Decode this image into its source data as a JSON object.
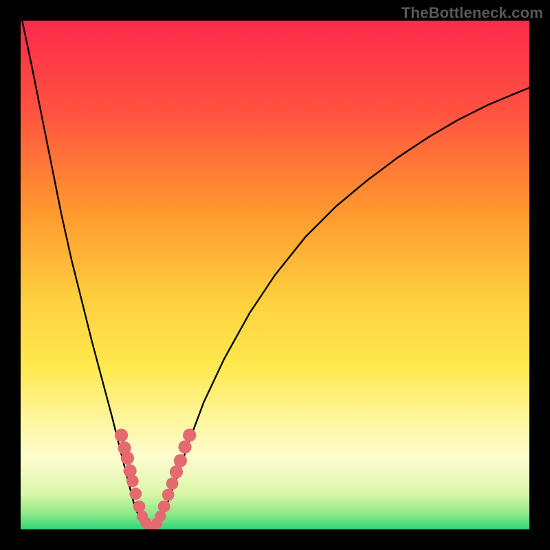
{
  "watermark": {
    "text": "TheBottleneck.com"
  },
  "chart_data": {
    "type": "line",
    "title": "",
    "xlabel": "",
    "ylabel": "",
    "xlim": [
      0,
      100
    ],
    "ylim": [
      0,
      100
    ],
    "gradient_stops": [
      {
        "offset": 0,
        "color": "#ff2a4d"
      },
      {
        "offset": 18,
        "color": "#ff5340"
      },
      {
        "offset": 38,
        "color": "#ff9a2e"
      },
      {
        "offset": 55,
        "color": "#ffd040"
      },
      {
        "offset": 68,
        "color": "#ffe94f"
      },
      {
        "offset": 78,
        "color": "#fff59a"
      },
      {
        "offset": 86,
        "color": "#fdfccf"
      },
      {
        "offset": 93,
        "color": "#d9f7a8"
      },
      {
        "offset": 97,
        "color": "#8de88a"
      },
      {
        "offset": 100,
        "color": "#2fd77a"
      }
    ],
    "series": [
      {
        "name": "curve",
        "points": [
          {
            "x": 0.3,
            "y": 100.0
          },
          {
            "x": 2.0,
            "y": 92.0
          },
          {
            "x": 4.0,
            "y": 82.0
          },
          {
            "x": 6.0,
            "y": 72.0
          },
          {
            "x": 8.0,
            "y": 62.0
          },
          {
            "x": 10.0,
            "y": 53.0
          },
          {
            "x": 12.0,
            "y": 45.0
          },
          {
            "x": 14.0,
            "y": 37.0
          },
          {
            "x": 16.0,
            "y": 29.5
          },
          {
            "x": 18.0,
            "y": 22.0
          },
          {
            "x": 19.5,
            "y": 16.0
          },
          {
            "x": 21.0,
            "y": 10.0
          },
          {
            "x": 22.3,
            "y": 5.0
          },
          {
            "x": 23.5,
            "y": 1.8
          },
          {
            "x": 24.5,
            "y": 0.4
          },
          {
            "x": 25.5,
            "y": 0.2
          },
          {
            "x": 26.5,
            "y": 0.4
          },
          {
            "x": 27.5,
            "y": 1.8
          },
          {
            "x": 29.0,
            "y": 5.5
          },
          {
            "x": 31.0,
            "y": 11.0
          },
          {
            "x": 33.0,
            "y": 17.0
          },
          {
            "x": 36.0,
            "y": 25.0
          },
          {
            "x": 40.0,
            "y": 33.5
          },
          {
            "x": 45.0,
            "y": 42.5
          },
          {
            "x": 50.0,
            "y": 50.0
          },
          {
            "x": 56.0,
            "y": 57.5
          },
          {
            "x": 62.0,
            "y": 63.5
          },
          {
            "x": 68.0,
            "y": 68.5
          },
          {
            "x": 74.0,
            "y": 73.0
          },
          {
            "x": 80.0,
            "y": 77.0
          },
          {
            "x": 86.0,
            "y": 80.5
          },
          {
            "x": 92.0,
            "y": 83.5
          },
          {
            "x": 98.0,
            "y": 86.0
          },
          {
            "x": 100.0,
            "y": 86.8
          }
        ]
      }
    ],
    "markers": {
      "name": "highlight-dots",
      "color": "#e46a6f",
      "points": [
        {
          "x": 19.8,
          "y": 18.5,
          "r": 1.3
        },
        {
          "x": 20.4,
          "y": 16.0,
          "r": 1.3
        },
        {
          "x": 21.0,
          "y": 14.0,
          "r": 1.3
        },
        {
          "x": 21.5,
          "y": 11.5,
          "r": 1.3
        },
        {
          "x": 22.0,
          "y": 9.5,
          "r": 1.2
        },
        {
          "x": 22.6,
          "y": 7.0,
          "r": 1.2
        },
        {
          "x": 23.3,
          "y": 4.5,
          "r": 1.2
        },
        {
          "x": 23.9,
          "y": 2.6,
          "r": 1.1
        },
        {
          "x": 24.6,
          "y": 1.3,
          "r": 1.1
        },
        {
          "x": 25.3,
          "y": 0.6,
          "r": 1.0
        },
        {
          "x": 26.0,
          "y": 0.5,
          "r": 1.0
        },
        {
          "x": 26.8,
          "y": 1.2,
          "r": 1.1
        },
        {
          "x": 27.5,
          "y": 2.6,
          "r": 1.1
        },
        {
          "x": 28.2,
          "y": 4.5,
          "r": 1.2
        },
        {
          "x": 29.0,
          "y": 6.8,
          "r": 1.2
        },
        {
          "x": 29.8,
          "y": 9.0,
          "r": 1.2
        },
        {
          "x": 30.6,
          "y": 11.3,
          "r": 1.3
        },
        {
          "x": 31.4,
          "y": 13.5,
          "r": 1.3
        },
        {
          "x": 32.3,
          "y": 16.2,
          "r": 1.3
        },
        {
          "x": 33.2,
          "y": 18.5,
          "r": 1.3
        }
      ]
    }
  }
}
